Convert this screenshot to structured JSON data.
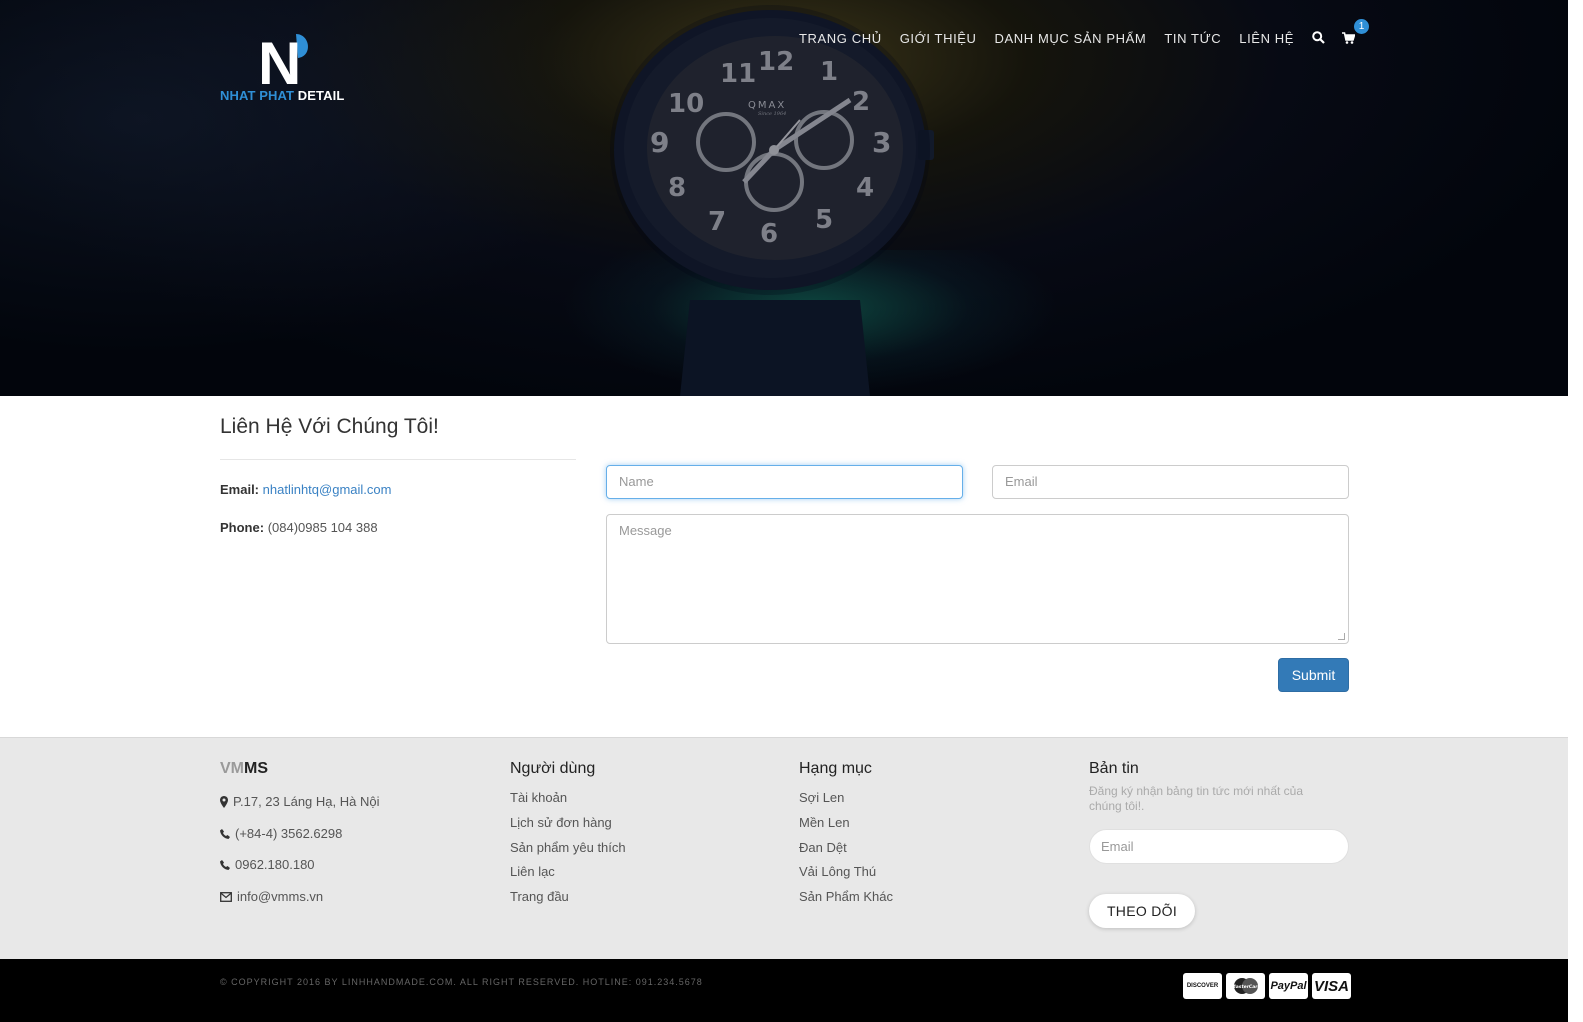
{
  "brand": {
    "logo_letter": "N",
    "name_part1": "NHAT PHAT",
    "name_part2": "DETAIL"
  },
  "nav": {
    "items": [
      "TRANG CHỦ",
      "GIỚI THIỆU",
      "DANH MỤC SẢN PHẨM",
      "TIN TỨC",
      "LIÊN HỆ"
    ],
    "search_icon": "search-icon",
    "cart_icon": "cart-icon",
    "cart_count": "1"
  },
  "hero": {
    "watch_brand": "QMAX",
    "watch_sub": "Since 1964"
  },
  "contact": {
    "title": "Liên Hệ Với Chúng Tôi!",
    "email_label": "Email:",
    "email_value": "nhatlinhtq@gmail.com",
    "phone_label": "Phone:",
    "phone_value": "(084)0985 104 388",
    "form": {
      "name_placeholder": "Name",
      "email_placeholder": "Email",
      "message_placeholder": "Message",
      "submit_label": "Submit"
    }
  },
  "footer": {
    "company": {
      "title_part1": "VM",
      "title_part2": "MS",
      "address": "P.17, 23 Láng Hạ, Hà Nội",
      "phone1": "(+84-4) 3562.6298",
      "phone2": "0962.180.180",
      "email": "info@vmms.vn"
    },
    "users": {
      "title": "Người dùng",
      "items": [
        "Tài khoản",
        "Lịch sử đơn hàng",
        "Sản phẩm yêu thích",
        "Liên lạc",
        "Trang đầu"
      ]
    },
    "categories": {
      "title": "Hạng mục",
      "items": [
        "Sợi Len",
        "Mền Len",
        "Đan Dệt",
        "Vải Lông Thú",
        "Sản Phẩm Khác"
      ]
    },
    "newsletter": {
      "title": "Bản tin",
      "description": "Đăng ký nhận bảng tin tức mới nhất của chúng tôi!.",
      "email_placeholder": "Email",
      "button_label": "THEO DÕI"
    }
  },
  "bottom": {
    "copyright": "© COPYRIGHT 2016 BY LINHHANDMADE.COM. ALL RIGHT RESERVED. HOTLINE: 091.234.5678",
    "payment_cards": [
      "DISCOVER",
      "MasterCard",
      "PayPal",
      "VISA"
    ]
  },
  "colors": {
    "accent": "#337ab7",
    "brand_blue": "#2f8fd6",
    "footer_bg": "#e8e8e8"
  }
}
